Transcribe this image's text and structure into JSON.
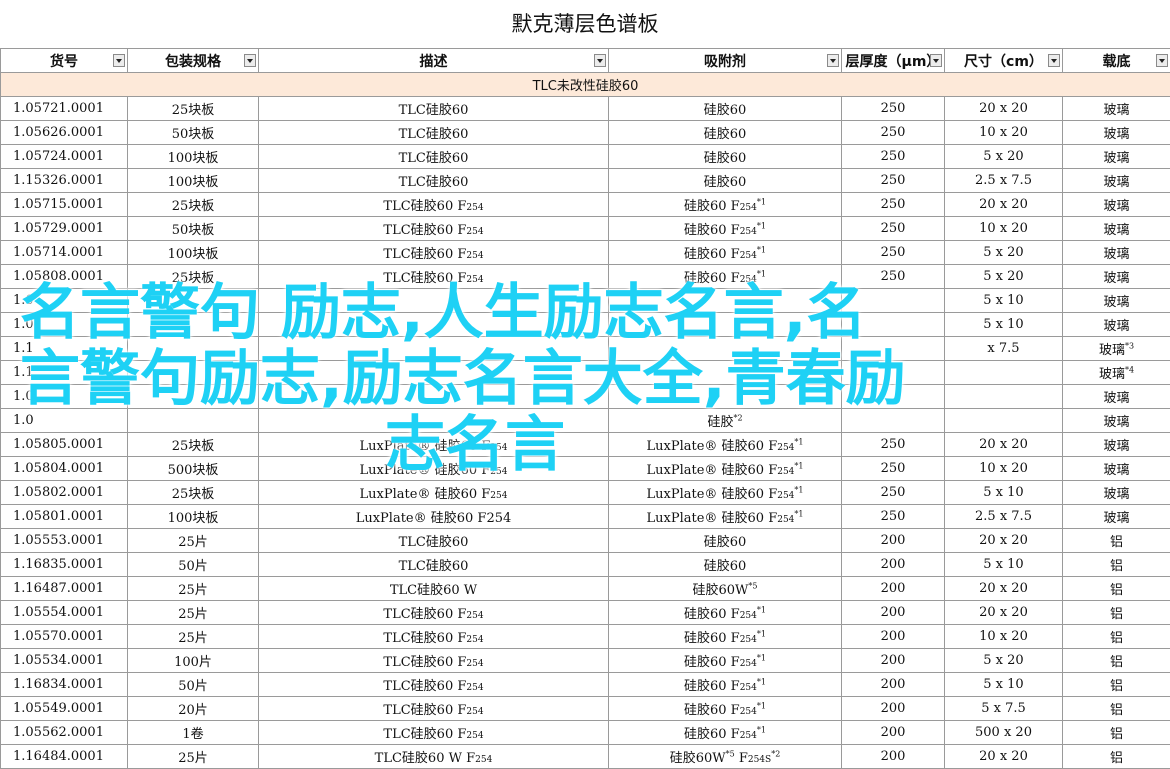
{
  "title": "默克薄层色谱板",
  "headers": [
    "货号",
    "包装规格",
    "描述",
    "吸附剂",
    "层厚度（μm）",
    "尺寸（cm）",
    "载底"
  ],
  "group_label": "TLC未改性硅胶60",
  "rows": [
    {
      "code": "1.05721.0001",
      "pack": "25块板",
      "desc": "TLC硅胶60",
      "desc_sub": "",
      "sorb": "硅胶60",
      "sorb_sub": "",
      "sorb_sup": "",
      "thick": "250",
      "size": "20 x 20",
      "sub": "玻璃",
      "sub_sup": ""
    },
    {
      "code": "1.05626.0001",
      "pack": "50块板",
      "desc": "TLC硅胶60",
      "desc_sub": "",
      "sorb": "硅胶60",
      "sorb_sub": "",
      "sorb_sup": "",
      "thick": "250",
      "size": "10 x 20",
      "sub": "玻璃",
      "sub_sup": ""
    },
    {
      "code": "1.05724.0001",
      "pack": "100块板",
      "desc": "TLC硅胶60",
      "desc_sub": "",
      "sorb": "硅胶60",
      "sorb_sub": "",
      "sorb_sup": "",
      "thick": "250",
      "size": "5 x 20",
      "sub": "玻璃",
      "sub_sup": ""
    },
    {
      "code": "1.15326.0001",
      "pack": "100块板",
      "desc": "TLC硅胶60",
      "desc_sub": "",
      "sorb": "硅胶60",
      "sorb_sub": "",
      "sorb_sup": "",
      "thick": "250",
      "size": "2.5 x 7.5",
      "sub": "玻璃",
      "sub_sup": ""
    },
    {
      "code": "1.05715.0001",
      "pack": "25块板",
      "desc": "TLC硅胶60 F",
      "desc_sub": "254",
      "sorb": "硅胶60 F",
      "sorb_sub": "254",
      "sorb_sup": "*1",
      "thick": "250",
      "size": "20 x 20",
      "sub": "玻璃",
      "sub_sup": ""
    },
    {
      "code": "1.05729.0001",
      "pack": "50块板",
      "desc": "TLC硅胶60 F",
      "desc_sub": "254",
      "sorb": "硅胶60 F",
      "sorb_sub": "254",
      "sorb_sup": "*1",
      "thick": "250",
      "size": "10 x 20",
      "sub": "玻璃",
      "sub_sup": ""
    },
    {
      "code": "1.05714.0001",
      "pack": "100块板",
      "desc": "TLC硅胶60 F",
      "desc_sub": "254",
      "sorb": "硅胶60 F",
      "sorb_sub": "254",
      "sorb_sup": "*1",
      "thick": "250",
      "size": "5 x 20",
      "sub": "玻璃",
      "sub_sup": ""
    },
    {
      "code": "1.05808.0001",
      "pack": "25块板",
      "desc": "TLC硅胶60 F",
      "desc_sub": "254",
      "sorb": "硅胶60 F",
      "sorb_sub": "254",
      "sorb_sup": "*1",
      "thick": "250",
      "size": "5 x 20",
      "sub": "玻璃",
      "sub_sup": ""
    },
    {
      "code": "1.0",
      "pack": "",
      "desc": "",
      "desc_sub": "",
      "sorb": "",
      "sorb_sub": "",
      "sorb_sup": "",
      "thick": "",
      "size": "5 x 10",
      "sub": "玻璃",
      "sub_sup": ""
    },
    {
      "code": "1.0",
      "pack": "",
      "desc": "",
      "desc_sub": "",
      "sorb": "",
      "sorb_sub": "",
      "sorb_sup": "",
      "thick": "",
      "size": "5 x 10",
      "sub": "玻璃",
      "sub_sup": ""
    },
    {
      "code": "1.1",
      "pack": "",
      "desc": "",
      "desc_sub": "",
      "sorb": "",
      "sorb_sub": "",
      "sorb_sup": "",
      "thick": "",
      "size": "x 7.5",
      "sub": "玻璃",
      "sub_sup": "*3"
    },
    {
      "code": "1.1",
      "pack": "",
      "desc": "",
      "desc_sub": "",
      "sorb": "",
      "sorb_sub": "",
      "sorb_sup": "",
      "thick": "",
      "size": "",
      "sub": "玻璃",
      "sub_sup": "*4"
    },
    {
      "code": "1.0",
      "pack": "",
      "desc": "",
      "desc_sub": "",
      "sorb": "",
      "sorb_sub": "",
      "sorb_sup": "",
      "thick": "",
      "size": "",
      "sub": "玻璃",
      "sub_sup": ""
    },
    {
      "code": "1.0",
      "pack": "",
      "desc": "",
      "desc_sub": "",
      "sorb": "硅胶",
      "sorb_sub": "",
      "sorb_sup": "*2",
      "thick": "",
      "size": "",
      "sub": "玻璃",
      "sub_sup": ""
    },
    {
      "code": "1.05805.0001",
      "pack": "25块板",
      "desc": "LuxPlate® 硅胶60 F",
      "desc_sub": "254",
      "sorb": "LuxPlate® 硅胶60 F",
      "sorb_sub": "254",
      "sorb_sup": "*1",
      "thick": "250",
      "size": "20 x 20",
      "sub": "玻璃",
      "sub_sup": ""
    },
    {
      "code": "1.05804.0001",
      "pack": "500块板",
      "desc": "LuxPlate® 硅胶60 F",
      "desc_sub": "254",
      "sorb": "LuxPlate® 硅胶60 F",
      "sorb_sub": "254",
      "sorb_sup": "*1",
      "thick": "250",
      "size": "10 x 20",
      "sub": "玻璃",
      "sub_sup": ""
    },
    {
      "code": "1.05802.0001",
      "pack": "25块板",
      "desc": "LuxPlate® 硅胶60 F",
      "desc_sub": "254",
      "sorb": "LuxPlate® 硅胶60 F",
      "sorb_sub": "254",
      "sorb_sup": "*1",
      "thick": "250",
      "size": "5 x 10",
      "sub": "玻璃",
      "sub_sup": ""
    },
    {
      "code": "1.05801.0001",
      "pack": "100块板",
      "desc": "LuxPlate® 硅胶60 F254",
      "desc_sub": "",
      "sorb": "LuxPlate® 硅胶60 F",
      "sorb_sub": "254",
      "sorb_sup": "*1",
      "thick": "250",
      "size": "2.5 x 7.5",
      "sub": "玻璃",
      "sub_sup": ""
    },
    {
      "code": "1.05553.0001",
      "pack": "25片",
      "desc": "TLC硅胶60",
      "desc_sub": "",
      "sorb": "硅胶60",
      "sorb_sub": "",
      "sorb_sup": "",
      "thick": "200",
      "size": "20 x 20",
      "sub": "铝",
      "sub_sup": ""
    },
    {
      "code": "1.16835.0001",
      "pack": "50片",
      "desc": "TLC硅胶60",
      "desc_sub": "",
      "sorb": "硅胶60",
      "sorb_sub": "",
      "sorb_sup": "",
      "thick": "200",
      "size": "5 x 10",
      "sub": "铝",
      "sub_sup": ""
    },
    {
      "code": "1.16487.0001",
      "pack": "25片",
      "desc": "TLC硅胶60 W",
      "desc_sub": "",
      "sorb": "硅胶60W",
      "sorb_sub": "",
      "sorb_sup": "*5",
      "thick": "200",
      "size": "20 x 20",
      "sub": "铝",
      "sub_sup": ""
    },
    {
      "code": "1.05554.0001",
      "pack": "25片",
      "desc": "TLC硅胶60 F",
      "desc_sub": "254",
      "sorb": "硅胶60 F",
      "sorb_sub": "254",
      "sorb_sup": "*1",
      "thick": "200",
      "size": "20 x 20",
      "sub": "铝",
      "sub_sup": ""
    },
    {
      "code": "1.05570.0001",
      "pack": "25片",
      "desc": "TLC硅胶60 F",
      "desc_sub": "254",
      "sorb": "硅胶60 F",
      "sorb_sub": "254",
      "sorb_sup": "*1",
      "thick": "200",
      "size": "10 x 20",
      "sub": "铝",
      "sub_sup": ""
    },
    {
      "code": "1.05534.0001",
      "pack": "100片",
      "desc": "TLC硅胶60 F",
      "desc_sub": "254",
      "sorb": "硅胶60 F",
      "sorb_sub": "254",
      "sorb_sup": "*1",
      "thick": "200",
      "size": "5 x 20",
      "sub": "铝",
      "sub_sup": ""
    },
    {
      "code": "1.16834.0001",
      "pack": "50片",
      "desc": "TLC硅胶60 F",
      "desc_sub": "254",
      "sorb": "硅胶60 F",
      "sorb_sub": "254",
      "sorb_sup": "*1",
      "thick": "200",
      "size": "5 x 10",
      "sub": "铝",
      "sub_sup": ""
    },
    {
      "code": "1.05549.0001",
      "pack": "20片",
      "desc": "TLC硅胶60 F",
      "desc_sub": "254",
      "sorb": "硅胶60 F",
      "sorb_sub": "254",
      "sorb_sup": "*1",
      "thick": "200",
      "size": "5 x 7.5",
      "sub": "铝",
      "sub_sup": ""
    },
    {
      "code": "1.05562.0001",
      "pack": "1卷",
      "desc": "TLC硅胶60 F",
      "desc_sub": "254",
      "sorb": "硅胶60 F",
      "sorb_sub": "254",
      "sorb_sup": "*1",
      "thick": "200",
      "size": "500 x 20",
      "sub": "铝",
      "sub_sup": ""
    },
    {
      "code": "1.16484.0001",
      "pack": "25片",
      "desc": "TLC硅胶60 W F",
      "desc_sub": "254",
      "sorb": "硅胶60W",
      "sorb_sub": "",
      "sorb_sup": "*5",
      "sorb2": " F",
      "sorb2_sub": "254S",
      "sorb2_sup": "*2",
      "thick": "200",
      "size": "20 x 20",
      "sub": "铝",
      "sub_sup": ""
    }
  ],
  "watermark": [
    "名言警句 励志,人生励志名言,名",
    "言警句励志,励志名言大全,青春励",
    "志名言"
  ]
}
